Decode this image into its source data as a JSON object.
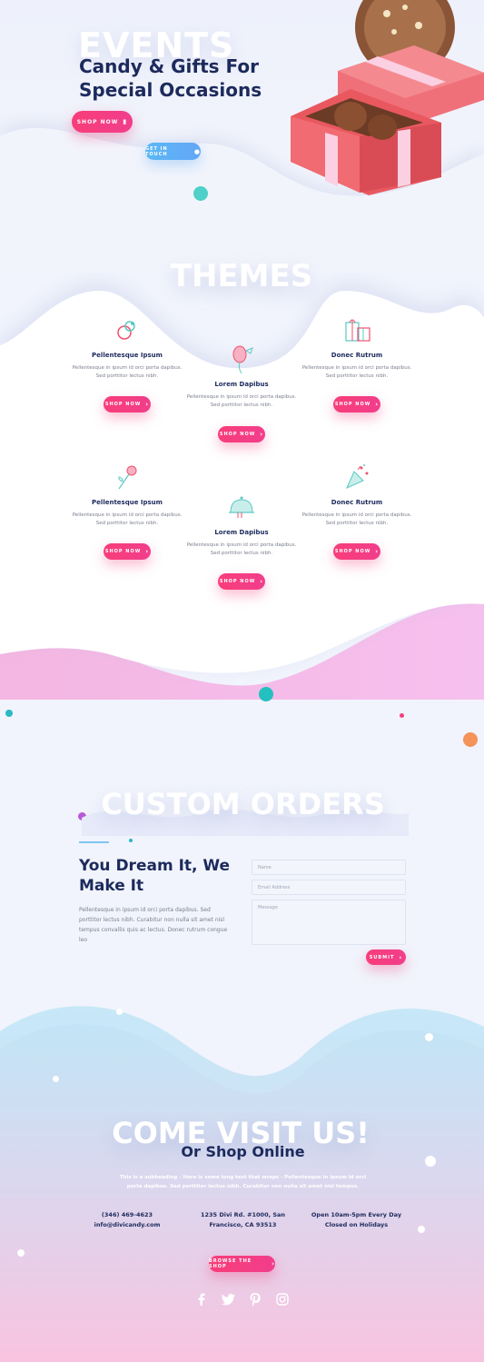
{
  "hero": {
    "bg_word": "EVENTS",
    "title": "Candy & Gifts For Special Occasions",
    "shop_now": "SHOP NOW",
    "get_in_touch": "GET IN TOUCH"
  },
  "themes": {
    "heading": "THEMES",
    "button_label": "SHOP NOW",
    "cards": [
      {
        "title": "Pellentesque Ipsum",
        "desc": "Pellentesque in ipsum id orci porta dapibus. Sed porttitor lectus nibh.",
        "icon": "pacifier-icon"
      },
      {
        "title": "Lorem Dapibus",
        "desc": "Pellentesque in ipsum id orci porta dapibus. Sed porttitor lectus nibh.",
        "icon": "balloon-icon"
      },
      {
        "title": "Donec Rutrum",
        "desc": "Pellentesque in ipsum id orci porta dapibus. Sed porttitor lectus nibh.",
        "icon": "gift-boxes-icon"
      },
      {
        "title": "Pellentesque Ipsum",
        "desc": "Pellentesque in ipsum id orci porta dapibus. Sed porttitor lectus nibh.",
        "icon": "rose-icon"
      },
      {
        "title": "Lorem Dapibus",
        "desc": "Pellentesque in ipsum id orci porta dapibus. Sed porttitor lectus nibh.",
        "icon": "cloche-icon"
      },
      {
        "title": "Donec Rutrum",
        "desc": "Pellentesque in ipsum id orci porta dapibus. Sed porttitor lectus nibh.",
        "icon": "party-popper-icon"
      }
    ]
  },
  "custom": {
    "heading": "CUSTOM ORDERS",
    "title": "You Dream It, We Make It",
    "body": "Pellentesque in ipsum id orci porta dapibus. Sed porttitor lectus nibh. Curabitur non nulla sit amet nisl tempus convallis quis ac lectus. Donec rutrum congue leo",
    "name_placeholder": "Name",
    "email_placeholder": "Email Address",
    "message_placeholder": "Message",
    "submit": "SUBMIT"
  },
  "visit": {
    "heading": "COME VISIT US!",
    "subheading": "Or Shop Online",
    "intro": "This is a subheading - Here is some long text that wraps - Pellentesque in ipsum id orci porta dapibus. Sed porttitor lectus nibh. Curabitur non nulla sit amet nisl tempus.",
    "phone": "(346) 469-4623",
    "email": "info@divicandy.com",
    "address_1": "1235 Divi Rd. #1000, San",
    "address_2": "Francisco, CA 93513",
    "hours_1": "Open 10am-5pm Every Day",
    "hours_2": "Closed on Holidays",
    "browse": "BROWSE THE SHOP"
  },
  "colors": {
    "accent_pink": "#f23f80",
    "accent_blue": "#5ab8f5",
    "navy": "#1c2a5c"
  }
}
